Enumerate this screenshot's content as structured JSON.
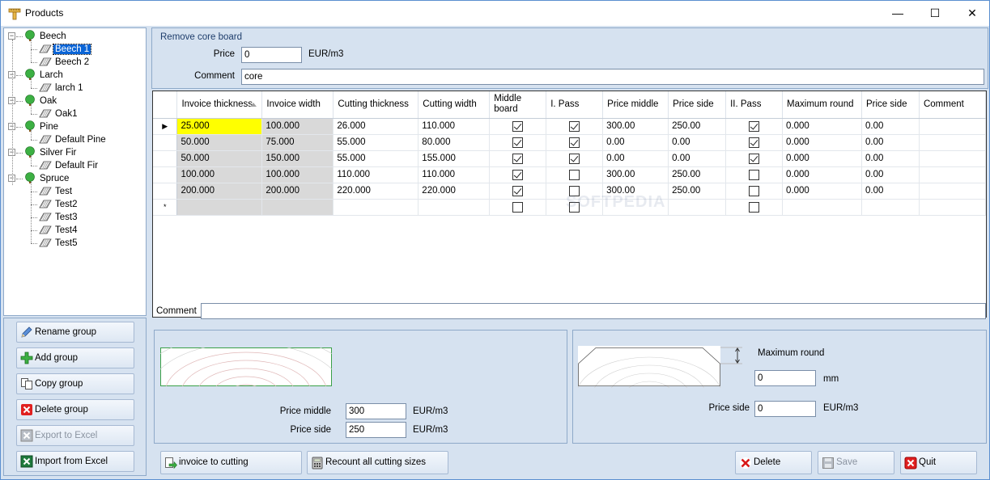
{
  "window": {
    "title": "Products",
    "minimize": "—",
    "maximize": "☐",
    "close": "✕"
  },
  "tree": {
    "groups": [
      {
        "label": "Beech",
        "children": [
          "Beech 1",
          "Beech 2"
        ]
      },
      {
        "label": "Larch",
        "children": [
          "larch 1"
        ]
      },
      {
        "label": "Oak",
        "children": [
          "Oak1"
        ]
      },
      {
        "label": "Pine",
        "children": [
          "Default Pine"
        ]
      },
      {
        "label": "Silver Fir",
        "children": [
          "Default Fir"
        ]
      },
      {
        "label": "Spruce",
        "children": [
          "Test",
          "Test2",
          "Test3",
          "Test4",
          "Test5"
        ]
      }
    ],
    "selected": "Beech 1"
  },
  "left_buttons": {
    "rename": "Rename group",
    "add": "Add group",
    "copy": "Copy group",
    "delete": "Delete group",
    "export": "Export to Excel",
    "import": "Import from Excel"
  },
  "top_group": {
    "title": "Remove core board",
    "price_label": "Price",
    "price_value": "0",
    "price_unit": "EUR/m3",
    "comment_label": "Comment",
    "comment_value": "core"
  },
  "grid": {
    "columns": [
      "Invoice thickness",
      "Invoice width",
      "Cutting thickness",
      "Cutting width",
      "Middle board",
      "I. Pass",
      "Price middle",
      "Price side",
      "II. Pass",
      "Maximum round",
      "Price side",
      "Comment"
    ],
    "rows": [
      [
        "25.000",
        "100.000",
        "26.000",
        "110.000",
        true,
        true,
        "300.00",
        "250.00",
        true,
        "0.000",
        "0.00",
        ""
      ],
      [
        "50.000",
        "75.000",
        "55.000",
        "80.000",
        true,
        true,
        "0.00",
        "0.00",
        true,
        "0.000",
        "0.00",
        ""
      ],
      [
        "50.000",
        "150.000",
        "55.000",
        "155.000",
        true,
        true,
        "0.00",
        "0.00",
        true,
        "0.000",
        "0.00",
        ""
      ],
      [
        "100.000",
        "100.000",
        "110.000",
        "110.000",
        true,
        false,
        "300.00",
        "250.00",
        false,
        "0.000",
        "0.00",
        ""
      ],
      [
        "200.000",
        "200.000",
        "220.000",
        "220.000",
        true,
        false,
        "300.00",
        "250.00",
        false,
        "0.000",
        "0.00",
        ""
      ]
    ],
    "current_row_marker": "▶",
    "new_row_marker": "*"
  },
  "comment": {
    "label": "Comment",
    "value": ""
  },
  "left_panel": {
    "price_middle_label": "Price middle",
    "price_middle_value": "300",
    "price_middle_unit": "EUR/m3",
    "price_side_label": "Price side",
    "price_side_value": "250",
    "price_side_unit": "EUR/m3"
  },
  "right_panel": {
    "max_round_label": "Maximum round",
    "max_round_value": "0",
    "max_round_unit": "mm",
    "price_side_label": "Price side",
    "price_side_value": "0",
    "price_side_unit": "EUR/m3"
  },
  "bottom_buttons": {
    "invoice_to_cutting": "invoice to cutting",
    "recount": "Recount all cutting sizes",
    "delete": "Delete",
    "save": "Save",
    "quit": "Quit"
  },
  "watermark": "SOFTPEDIA",
  "colors": {
    "selection": "#0a64d6",
    "highlight_cell": "#ffff00",
    "readonly_cell": "#d9d9d9",
    "panel_bg": "#d6e2f0"
  }
}
